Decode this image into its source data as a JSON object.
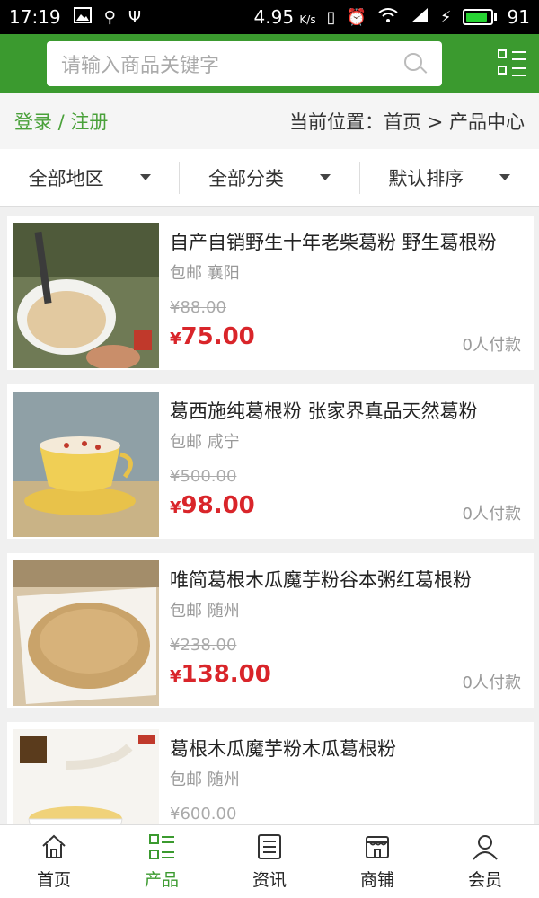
{
  "status_bar": {
    "time": "17:19",
    "net_speed": "4.95",
    "net_unit": "K/s",
    "battery": "91",
    "battery_level": 0.91,
    "battery_color": "#27d433"
  },
  "header": {
    "search_placeholder": "请输入商品关键字",
    "brand_color": "#3b9a2f"
  },
  "breadcrumb": {
    "login": "登录 / 注册",
    "location": "当前位置：首页 > 产品中心"
  },
  "filters": [
    {
      "label": "全部地区"
    },
    {
      "label": "全部分类"
    },
    {
      "label": "默认排序"
    }
  ],
  "products": [
    {
      "title": "自产自销野生十年老柴葛粉 野生葛根粉",
      "shipping": "包邮",
      "city": "襄阳",
      "old_price": "¥88.00",
      "currency": "¥",
      "price": "75.00",
      "paid": "0人付款",
      "image_icon": "kudzu-drink-photo"
    },
    {
      "title": "葛西施纯葛根粉 张家界真品天然葛粉",
      "shipping": "包邮",
      "city": "咸宁",
      "old_price": "¥500.00",
      "currency": "¥",
      "price": "98.00",
      "paid": "0人付款",
      "image_icon": "teacup-photo"
    },
    {
      "title": "唯简葛根木瓜魔芋粉谷本粥红葛根粉",
      "shipping": "包邮",
      "city": "随州",
      "old_price": "¥238.00",
      "currency": "¥",
      "price": "138.00",
      "paid": "0人付款",
      "image_icon": "powder-photo"
    },
    {
      "title": "葛根木瓜魔芋粉木瓜葛根粉",
      "shipping": "包邮",
      "city": "随州",
      "old_price": "¥600.00",
      "currency": "¥",
      "price": "",
      "paid": "",
      "image_icon": "cup-spoon-photo"
    }
  ],
  "tabbar": {
    "items": [
      {
        "label": "首页",
        "icon": "home-icon"
      },
      {
        "label": "产品",
        "icon": "list-icon"
      },
      {
        "label": "资讯",
        "icon": "news-icon"
      },
      {
        "label": "商铺",
        "icon": "shop-icon"
      },
      {
        "label": "会员",
        "icon": "user-icon"
      }
    ],
    "active_color": "#3b9a2f"
  }
}
